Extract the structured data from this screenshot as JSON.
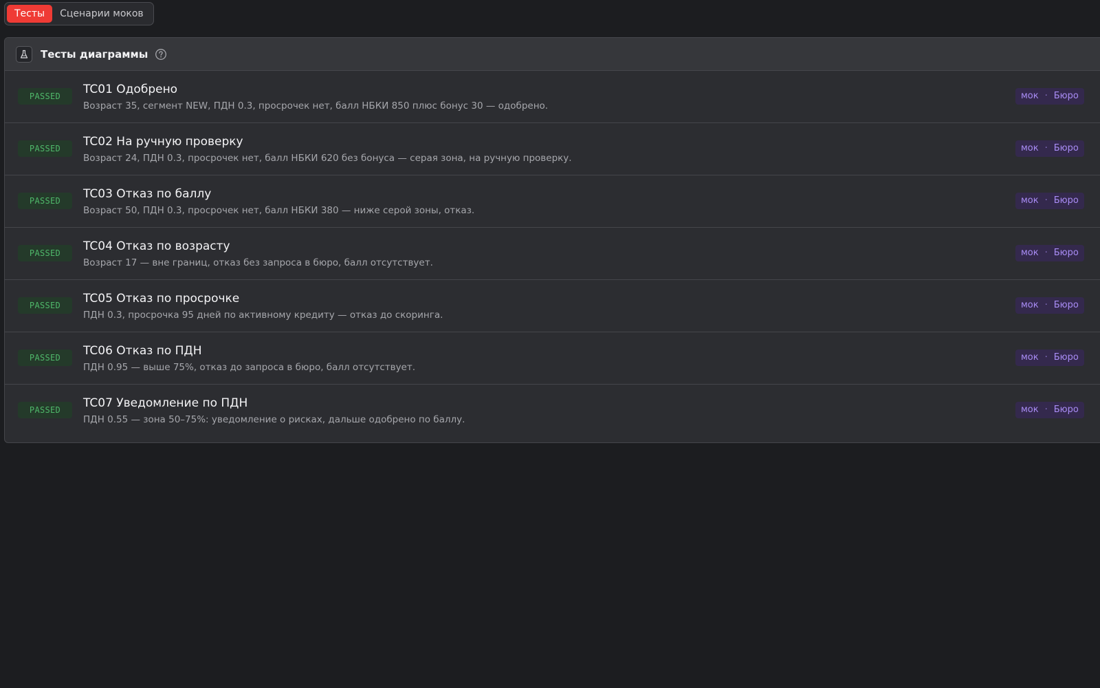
{
  "tabs": [
    {
      "label": "Тесты",
      "active": true
    },
    {
      "label": "Сценарии моков",
      "active": false
    }
  ],
  "panel": {
    "title": "Тесты диаграммы",
    "icon": "flask-icon",
    "help_icon": "question-circle-icon"
  },
  "tests": [
    {
      "status": "PASSED",
      "title": "TC01 Одобрено",
      "desc": "Возраст 35, сегмент NEW, ПДН 0.3, просрочек нет, балл НБКИ 850 плюс бонус 30 — одобрено.",
      "tag_mock": "мок",
      "tag_bureau": "Бюро"
    },
    {
      "status": "PASSED",
      "title": "TC02 На ручную проверку",
      "desc": "Возраст 24, ПДН 0.3, просрочек нет, балл НБКИ 620 без бонуса — серая зона, на ручную проверку.",
      "tag_mock": "мок",
      "tag_bureau": "Бюро"
    },
    {
      "status": "PASSED",
      "title": "TC03 Отказ по баллу",
      "desc": "Возраст 50, ПДН 0.3, просрочек нет, балл НБКИ 380 — ниже серой зоны, отказ.",
      "tag_mock": "мок",
      "tag_bureau": "Бюро"
    },
    {
      "status": "PASSED",
      "title": "TC04 Отказ по возрасту",
      "desc": "Возраст 17 — вне границ, отказ без запроса в бюро, балл отсутствует.",
      "tag_mock": "мок",
      "tag_bureau": "Бюро"
    },
    {
      "status": "PASSED",
      "title": "TC05 Отказ по просрочке",
      "desc": "ПДН 0.3, просрочка 95 дней по активному кредиту — отказ до скоринга.",
      "tag_mock": "мок",
      "tag_bureau": "Бюро"
    },
    {
      "status": "PASSED",
      "title": "TC06 Отказ по ПДН",
      "desc": "ПДН 0.95 — выше 75%, отказ до запроса в бюро, балл отсутствует.",
      "tag_mock": "мок",
      "tag_bureau": "Бюро"
    },
    {
      "status": "PASSED",
      "title": "TC07 Уведомление по ПДН",
      "desc": "ПДН 0.55 — зона 50–75%: уведомление о рисках, дальше одобрено по баллу.",
      "tag_mock": "мок",
      "tag_bureau": "Бюро"
    }
  ],
  "colors": {
    "background": "#1c1d20",
    "accent": "#ef3b35",
    "passed": "#4fb86a",
    "tag": "#a98cf5"
  }
}
